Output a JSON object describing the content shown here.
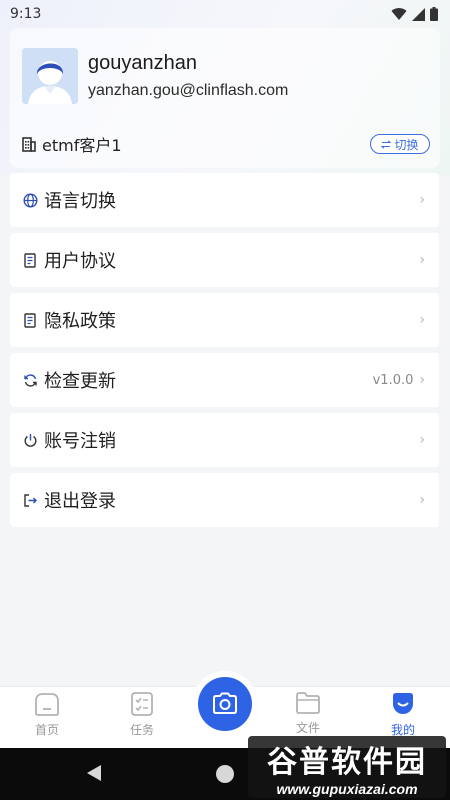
{
  "status": {
    "time": "9:13"
  },
  "profile": {
    "username": "gouyanzhan",
    "email": "yanzhan.gou@clinflash.com",
    "tenant": "etmf客户1",
    "switch_label": "切换"
  },
  "menu": [
    {
      "label": "语言切换",
      "icon": "globe-icon",
      "value": ""
    },
    {
      "label": "用户协议",
      "icon": "document-icon",
      "value": ""
    },
    {
      "label": "隐私政策",
      "icon": "document-icon",
      "value": ""
    },
    {
      "label": "检查更新",
      "icon": "refresh-icon",
      "value": "v1.0.0"
    },
    {
      "label": "账号注销",
      "icon": "power-icon",
      "value": ""
    },
    {
      "label": "退出登录",
      "icon": "logout-icon",
      "value": ""
    }
  ],
  "tabs": {
    "home": "首页",
    "tasks": "任务",
    "files": "文件",
    "mine": "我的"
  },
  "watermark": {
    "title": "谷普软件园",
    "url": "www.gupuxiazai.com"
  },
  "colors": {
    "accent": "#2f63e6",
    "background": "#f4f5f7"
  }
}
